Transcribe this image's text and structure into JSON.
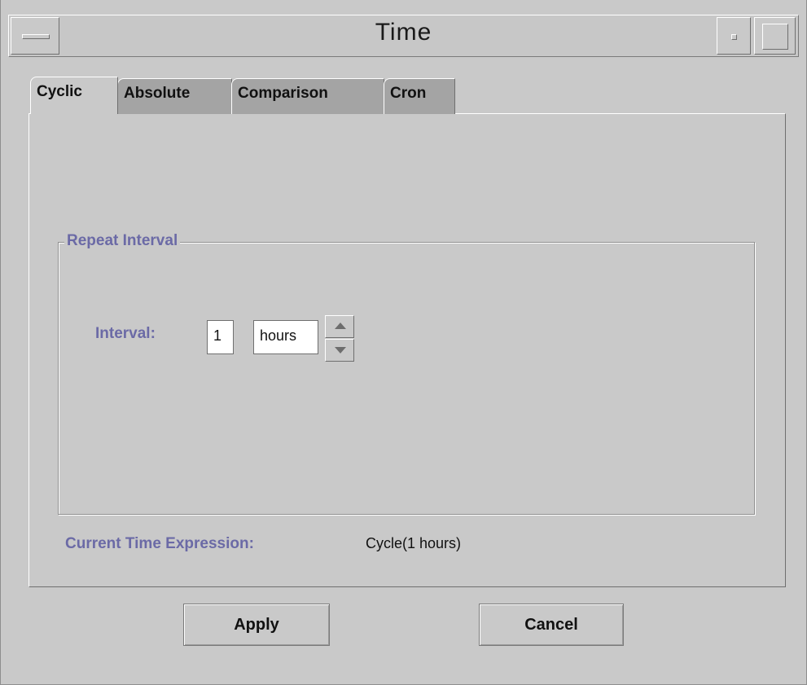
{
  "window": {
    "title": "Time"
  },
  "tabs": [
    {
      "label": "Cyclic",
      "active": true
    },
    {
      "label": "Absolute",
      "active": false
    },
    {
      "label": "Comparison",
      "active": false
    },
    {
      "label": "Cron",
      "active": false
    }
  ],
  "repeat_interval": {
    "legend": "Repeat Interval",
    "interval_label": "Interval:",
    "interval_value": "1",
    "unit_value": "hours"
  },
  "current_expression": {
    "label": "Current Time Expression:",
    "value": "Cycle(1 hours)"
  },
  "buttons": {
    "apply_label": "Apply",
    "cancel_label": "Cancel"
  },
  "colors": {
    "background": "#c9c9c9",
    "label_accent": "#6b6aa6",
    "inactive_tab": "#a4a4a4"
  },
  "icons": {
    "spin_up": "triangle-up-icon",
    "spin_down": "triangle-down-icon"
  }
}
